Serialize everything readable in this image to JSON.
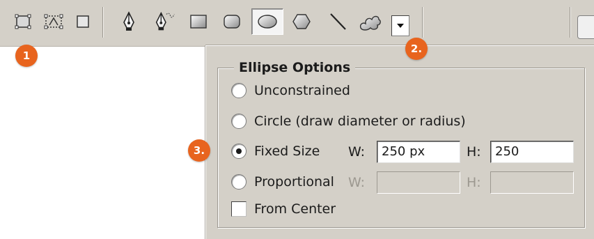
{
  "toolbar": {
    "tools": [
      {
        "name": "shape-layers-mode-icon",
        "selected": false
      },
      {
        "name": "paths-mode-icon",
        "selected": false
      },
      {
        "name": "fill-pixels-mode-icon",
        "selected": false
      },
      {
        "name": "pen-tool-icon",
        "selected": false
      },
      {
        "name": "freeform-pen-tool-icon",
        "selected": false
      },
      {
        "name": "rectangle-tool-icon",
        "selected": false
      },
      {
        "name": "rounded-rectangle-tool-icon",
        "selected": false
      },
      {
        "name": "ellipse-tool-icon",
        "selected": true
      },
      {
        "name": "polygon-tool-icon",
        "selected": false
      },
      {
        "name": "line-tool-icon",
        "selected": false
      },
      {
        "name": "custom-shape-tool-icon",
        "selected": false
      }
    ],
    "dropdown_icon": "triangle-down-icon"
  },
  "callouts": {
    "one": "1",
    "two": "2.",
    "three": "3."
  },
  "ellipse_options": {
    "title": "Ellipse Options",
    "options": [
      {
        "label": "Unconstrained",
        "checked": false
      },
      {
        "label": "Circle (draw diameter or radius)",
        "checked": false
      },
      {
        "label": "Fixed Size",
        "checked": true
      },
      {
        "label": "Proportional",
        "checked": false
      }
    ],
    "fixed_size": {
      "w_label": "W:",
      "w_value": "250 px",
      "h_label": "H:",
      "h_value": "250"
    },
    "proportional": {
      "w_label": "W:",
      "w_value": "",
      "h_label": "H:",
      "h_value": ""
    },
    "from_center": {
      "label": "From Center",
      "checked": false
    }
  },
  "colors": {
    "panel_bg": "#d4d0c8",
    "callout": "#e8641e"
  }
}
